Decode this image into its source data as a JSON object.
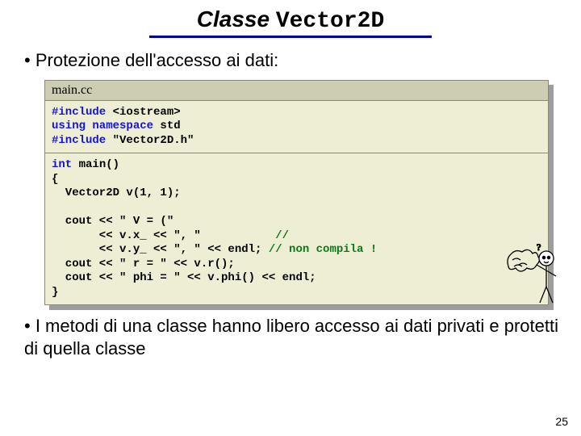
{
  "title": {
    "prefix": "Classe ",
    "mono": "Vector2D"
  },
  "bullets": {
    "top": "Protezione dell'accesso ai dati:",
    "bottom": "I metodi di una classe hanno libero accesso ai dati privati e protetti di quella classe"
  },
  "code": {
    "filename": "main.cc",
    "sec1_l1a": "#include ",
    "sec1_l1b": "<iostream>",
    "sec1_l2a": "using namespace ",
    "sec1_l2b": "std",
    "sec1_l3a": "#include ",
    "sec1_l3b": "\"Vector2D.h\"",
    "sec2_l1a": "int ",
    "sec2_l1b": "main()",
    "sec2_l2": "{",
    "sec2_l3": "  Vector2D v(1, 1);",
    "sec2_blank": "",
    "sec2_l4a": "  cout << \" V = (\" ",
    "sec2_l5a": "       << v.x_ << \", \"           ",
    "sec2_l5b": "//",
    "sec2_l6a": "       << v.y_ << \", \" << endl; ",
    "sec2_l6b": "// non compila !",
    "sec2_l7": "  cout << \" r = \" << v.r();",
    "sec2_l8": "  cout << \" phi = \" << v.phi() << endl;",
    "sec2_l9": "}"
  },
  "pageNumber": "25"
}
